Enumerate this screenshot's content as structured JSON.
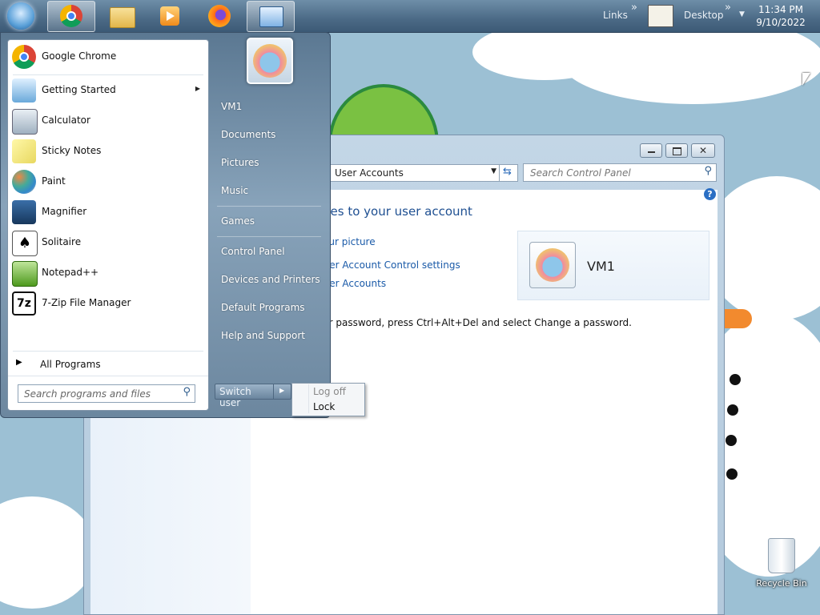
{
  "taskbar": {
    "links_label": "Links",
    "desktop_label": "Desktop",
    "more_glyph": "»",
    "clock_time": "11:34 PM",
    "clock_date": "9/10/2022"
  },
  "start_menu": {
    "pinned": [
      {
        "label": "Google Chrome",
        "icon": "chrome-icon"
      },
      {
        "label": "Getting Started",
        "icon": "getting-started-icon"
      },
      {
        "label": "Calculator",
        "icon": "calculator-icon"
      },
      {
        "label": "Sticky Notes",
        "icon": "sticky-notes-icon"
      },
      {
        "label": "Paint",
        "icon": "paint-icon"
      },
      {
        "label": "Magnifier",
        "icon": "magnifier-icon"
      },
      {
        "label": "Solitaire",
        "icon": "solitaire-icon"
      },
      {
        "label": "Notepad++",
        "icon": "notepad-plus-plus-icon"
      },
      {
        "label": "7-Zip File Manager",
        "icon": "7zip-icon"
      }
    ],
    "all_programs": "All Programs",
    "search_placeholder": "Search programs and files",
    "right": {
      "user": "VM1",
      "documents": "Documents",
      "pictures": "Pictures",
      "music": "Music",
      "games": "Games",
      "control_panel": "Control Panel",
      "devices": "Devices and Printers",
      "default_programs": "Default Programs",
      "help": "Help and Support"
    },
    "switch_user": "Switch user",
    "popup": {
      "log_off": "Log off",
      "lock": "Lock"
    }
  },
  "window": {
    "address": "User Accounts",
    "search_placeholder": "Search Control Panel",
    "heading": "ges to your user account",
    "links": {
      "picture": "our picture",
      "uac": "ser Account Control settings",
      "accounts": "ser Accounts"
    },
    "password_note": "ur password, press Ctrl+Alt+Del and select Change a password.",
    "user_name": "VM1"
  },
  "desktop": {
    "recycle_bin": "Recycle Bin"
  },
  "colors": {
    "link": "#1a5aa8",
    "heading": "#1e4f91",
    "taskbar": "#4b6a86"
  }
}
